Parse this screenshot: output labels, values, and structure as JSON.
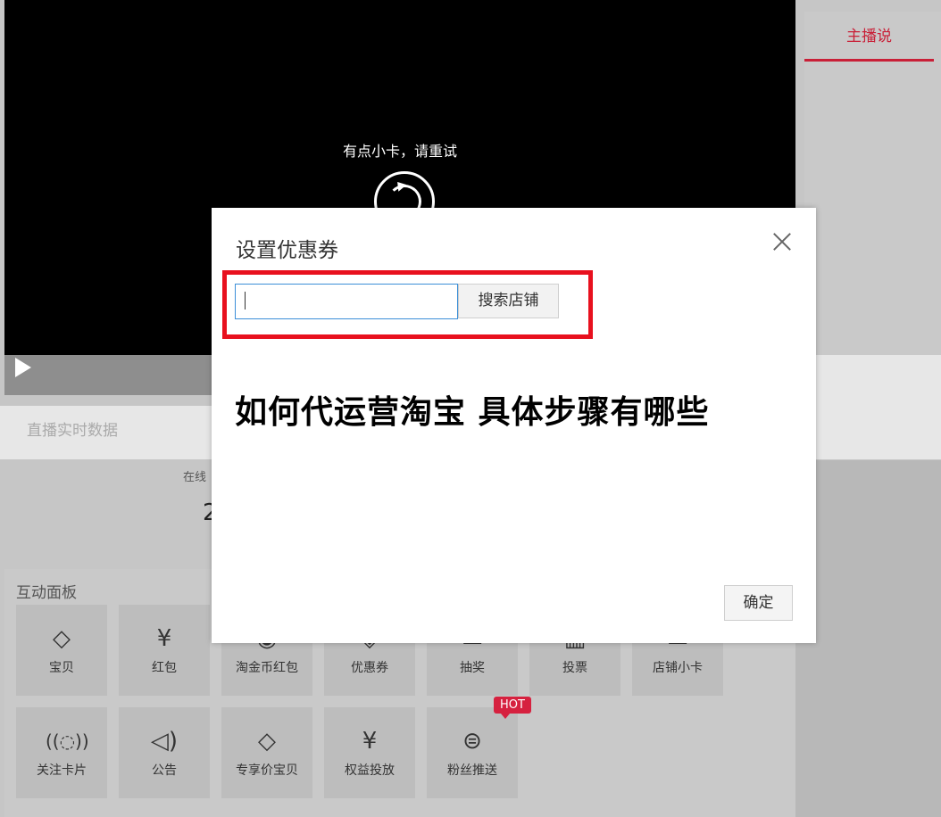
{
  "video": {
    "message": "有点小卡，请重试"
  },
  "right_panel": {
    "tab_label": "主播说"
  },
  "data_section": {
    "title": "直播实时数据",
    "stat_label": "在线",
    "stat_value": "2"
  },
  "interaction_panel": {
    "title": "互动面板",
    "tools_row1": [
      {
        "label": "宝贝",
        "icon": "tag-icon"
      },
      {
        "label": "红包",
        "icon": "red-packet-icon"
      },
      {
        "label": "淘金币红包",
        "icon": "coin-packet-icon"
      },
      {
        "label": "优惠券",
        "icon": "coupon-icon"
      },
      {
        "label": "抽奖",
        "icon": "lottery-icon"
      },
      {
        "label": "投票",
        "icon": "vote-icon"
      },
      {
        "label": "店铺小卡",
        "icon": "shop-card-icon"
      }
    ],
    "tools_row2": [
      {
        "label": "关注卡片",
        "icon": "broadcast-icon"
      },
      {
        "label": "公告",
        "icon": "speaker-icon"
      },
      {
        "label": "专享价宝贝",
        "icon": "tag-icon"
      },
      {
        "label": "权益投放",
        "icon": "red-packet-icon"
      },
      {
        "label": "粉丝推送",
        "icon": "chat-icon",
        "badge": "HOT"
      }
    ]
  },
  "modal": {
    "title": "设置优惠券",
    "search_value": "",
    "search_button": "搜索店铺",
    "article_title": "如何代运营淘宝 具体步骤有哪些",
    "confirm_button": "确定"
  },
  "colors": {
    "accent": "#c91f37",
    "highlight_border": "#e8101e",
    "hot_badge": "#d6213f"
  }
}
